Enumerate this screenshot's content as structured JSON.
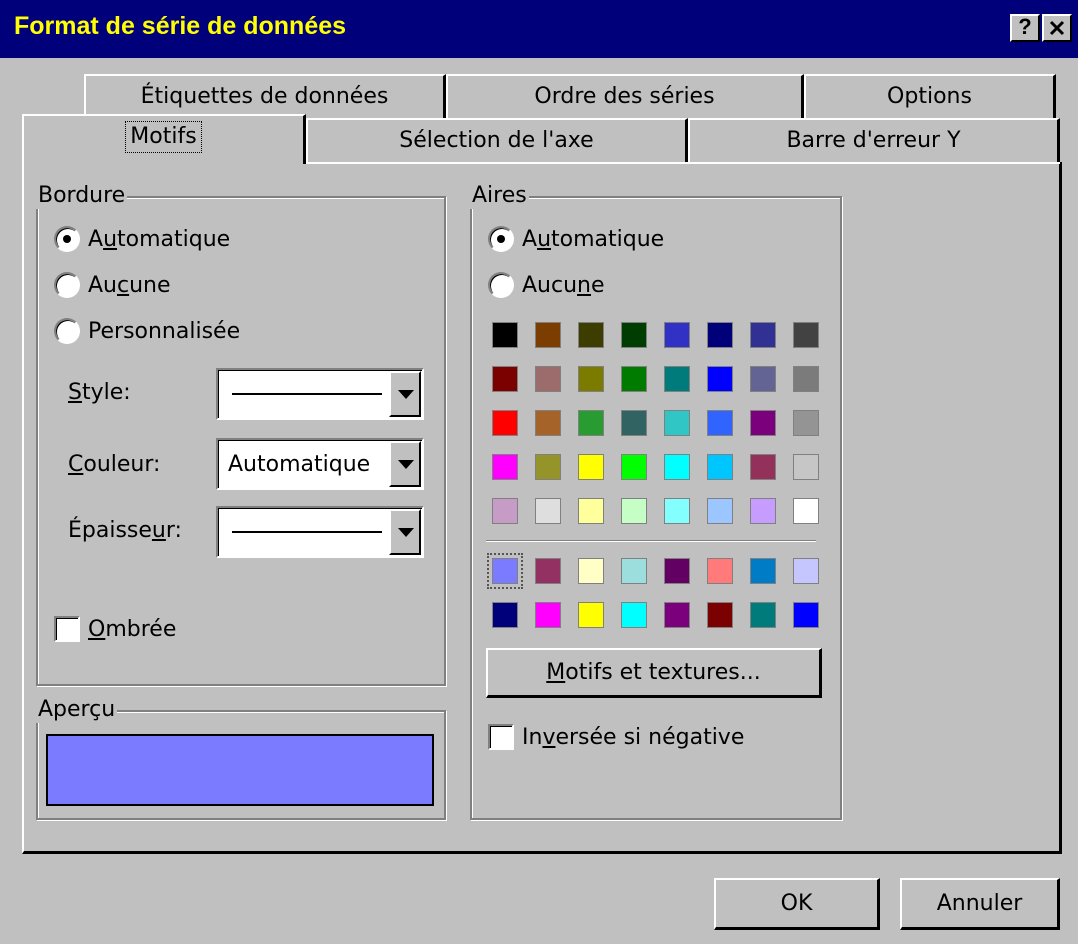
{
  "window": {
    "title": "Format de série de données",
    "help_label": "?",
    "close_label": "✕"
  },
  "tabs": {
    "back": [
      "Étiquettes de données",
      "Ordre des séries",
      "Options"
    ],
    "front": [
      "Motifs",
      "Sélection de l'axe",
      "Barre d'erreur Y"
    ],
    "active": "Motifs"
  },
  "bordure": {
    "title": "Bordure",
    "radio_auto": {
      "before": "A",
      "key": "u",
      "after": "tomatique"
    },
    "radio_none": {
      "before": "Au",
      "key": "c",
      "after": "une"
    },
    "radio_custom": "Personnalisée",
    "selected": "Automatique",
    "style_label": {
      "before": "",
      "key": "S",
      "after": "tyle:"
    },
    "couleur_label": {
      "before": "",
      "key": "C",
      "after": "ouleur:"
    },
    "couleur_value": "Automatique",
    "epaisseur_label": {
      "before": "Épaisse",
      "key": "u",
      "after": "r:"
    },
    "shadow": {
      "before": "",
      "key": "O",
      "after": "mbrée",
      "checked": false
    }
  },
  "apercu": {
    "title": "Aperçu",
    "color": "#7b7bff"
  },
  "aires": {
    "title": "Aires",
    "radio_auto": {
      "before": "A",
      "key": "u",
      "after": "tomatique"
    },
    "radio_none": {
      "before": "Aucu",
      "key": "n",
      "after": "e"
    },
    "selected": "Automatique",
    "palette": [
      [
        "#000000",
        "#7b3d00",
        "#3d3d00",
        "#003d00",
        "#3131c6",
        "#00007b",
        "#313194",
        "#424242"
      ],
      [
        "#7b0000",
        "#9c6b6b",
        "#7b7b00",
        "#007b00",
        "#007b7b",
        "#0000ff",
        "#636394",
        "#7b7b7b"
      ],
      [
        "#ff0000",
        "#a5632a",
        "#299c31",
        "#316363",
        "#31c6c6",
        "#3163ff",
        "#7b007b",
        "#949494"
      ],
      [
        "#ff00ff",
        "#94942a",
        "#ffff00",
        "#00ff00",
        "#00ffff",
        "#00c6ff",
        "#94315a",
        "#c6c6c6"
      ],
      [
        "#c69cc6",
        "#dedede",
        "#ffff9c",
        "#c6ffc6",
        "#84ffff",
        "#9cc6ff",
        "#c69cff",
        "#ffffff"
      ]
    ],
    "chart_palette": [
      [
        "#7b7bff",
        "#943163",
        "#ffffc6",
        "#9cdede",
        "#630063",
        "#ff7b7b",
        "#007bc6",
        "#c6c6ff"
      ],
      [
        "#00007b",
        "#ff00ff",
        "#ffff00",
        "#00ffff",
        "#7b007b",
        "#7b0000",
        "#007b7b",
        "#0000ff"
      ]
    ],
    "selected_color": "#7b7bff",
    "button": {
      "before": "",
      "key": "M",
      "after": "otifs et textures..."
    },
    "invert": {
      "before": "In",
      "key": "v",
      "after": "ersée si négative",
      "checked": false
    }
  },
  "buttons": {
    "ok": "OK",
    "cancel": "Annuler"
  }
}
